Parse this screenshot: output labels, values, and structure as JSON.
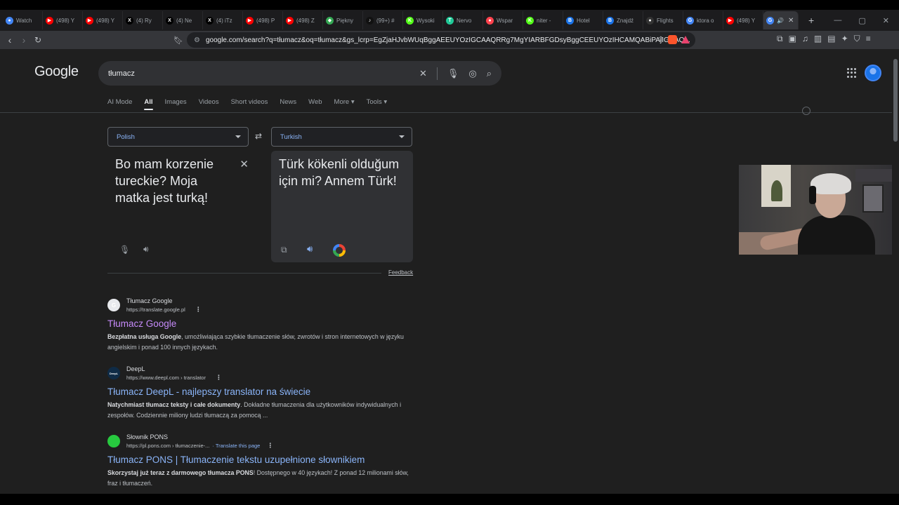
{
  "browser": {
    "tabs": [
      {
        "label": "Watch",
        "icon": "watch-icon",
        "color": "#4285f4",
        "glyph": "●"
      },
      {
        "label": "(498) Y",
        "icon": "youtube-icon",
        "color": "#ff0000",
        "glyph": "▶"
      },
      {
        "label": "(498) Y",
        "icon": "youtube-icon",
        "color": "#ff0000",
        "glyph": "▶"
      },
      {
        "label": "(4) Ry",
        "icon": "x-icon",
        "color": "#000000",
        "glyph": "X"
      },
      {
        "label": "(4) Ne",
        "icon": "x-icon",
        "color": "#000000",
        "glyph": "X"
      },
      {
        "label": "(4) iTz",
        "icon": "x-icon",
        "color": "#000000",
        "glyph": "X"
      },
      {
        "label": "(498) P",
        "icon": "youtube-icon",
        "color": "#ff0000",
        "glyph": "▶"
      },
      {
        "label": "(498) Z",
        "icon": "youtube-icon",
        "color": "#ff0000",
        "glyph": "▶"
      },
      {
        "label": "Piękny",
        "icon": "maps-pin-icon",
        "color": "#34a853",
        "glyph": "◆"
      },
      {
        "label": "(99+) #",
        "icon": "tiktok-icon",
        "color": "#111111",
        "glyph": "♪"
      },
      {
        "label": "Wysoki",
        "icon": "kick-icon",
        "color": "#53fc18",
        "glyph": "K"
      },
      {
        "label": "Nervo",
        "icon": "t-icon",
        "color": "#20c997",
        "glyph": "T"
      },
      {
        "label": "Wspar",
        "icon": "patreon-icon",
        "color": "#ff424d",
        "glyph": "●"
      },
      {
        "label": "niter -",
        "icon": "kick-icon",
        "color": "#53fc18",
        "glyph": "K"
      },
      {
        "label": "Hotel",
        "icon": "booking-icon",
        "color": "#1a73e8",
        "glyph": "B"
      },
      {
        "label": "Znajdź",
        "icon": "booking-icon",
        "color": "#1a73e8",
        "glyph": "B"
      },
      {
        "label": "Flights",
        "icon": "github-icon",
        "color": "#333333",
        "glyph": "●"
      },
      {
        "label": "ktora o",
        "icon": "google-icon",
        "color": "#4285f4",
        "glyph": "G"
      },
      {
        "label": "(498) Y",
        "icon": "youtube-icon",
        "color": "#ff0000",
        "glyph": "▶"
      }
    ],
    "active_tab": {
      "label": "🔊",
      "close": "✕"
    },
    "new_tab": "+",
    "window_controls": [
      "—",
      "▢",
      "✕"
    ],
    "url": "google.com/search?q=tłumacz&oq=tłumacz&gs_lcrp=EgZjaHJvbWUqBggAEEUYOzIGCAAQRRg7MgYIARBFGDsyBggCEEUYOzIHCAMQABiPAjIGCAQ...",
    "brave_badge": "10"
  },
  "search": {
    "logo": "Google",
    "query": "tłumacz",
    "tabs": [
      "AI Mode",
      "All",
      "Images",
      "Videos",
      "Short videos",
      "News",
      "Web",
      "More ▾",
      "Tools ▾"
    ],
    "active_tab": "All"
  },
  "translator": {
    "source_lang": "Polish",
    "target_lang": "Turkish",
    "source_text": "Bo mam korzenie tureckie? Moja matka jest turką!",
    "target_text": "Türk kökenli olduğum için mi? Annem Türk!",
    "feedback": "Feedback"
  },
  "results": [
    {
      "site": "Tłumacz Google",
      "url": "https://translate.google.pl",
      "translate_link": "",
      "title": "Tłumacz Google",
      "visited": true,
      "snippet_bold": "Bezpłatna usługa Google",
      "snippet": ", umożliwiająca szybkie tłumaczenie słów, zwrotów i stron internetowych w języku angielskim i ponad 100 innych językach.",
      "fav_color": "#e8eaed",
      "fav_text": "G"
    },
    {
      "site": "DeepL",
      "url": "https://www.deepl.com › translator",
      "translate_link": "",
      "title": "Tłumacz DeepL - najlepszy translator na świecie",
      "visited": false,
      "snippet_bold": "Natychmiast tłumacz teksty i całe dokumenty",
      "snippet": ". Dokładne tłumaczenia dla użytkowników indywidualnych i zespołów. Codziennie miliony ludzi tłumaczą za pomocą ...",
      "fav_color": "#0f2b46",
      "fav_text": "DeepL"
    },
    {
      "site": "Słownik PONS",
      "url": "https://pl.pons.com › tłumaczenie-...",
      "translate_link": "· Translate this page",
      "title": "Tłumacz PONS | Tłumaczenie tekstu uzupełnione słownikiem",
      "visited": false,
      "snippet_bold": "Skorzystaj już teraz z darmowego tłumacza PONS",
      "snippet": "! Dostępnego w 40 językach! Z ponad 12 milionami słów, fraz i tłumaczeń.",
      "fav_color": "#27c93f",
      "fav_text": ""
    }
  ]
}
